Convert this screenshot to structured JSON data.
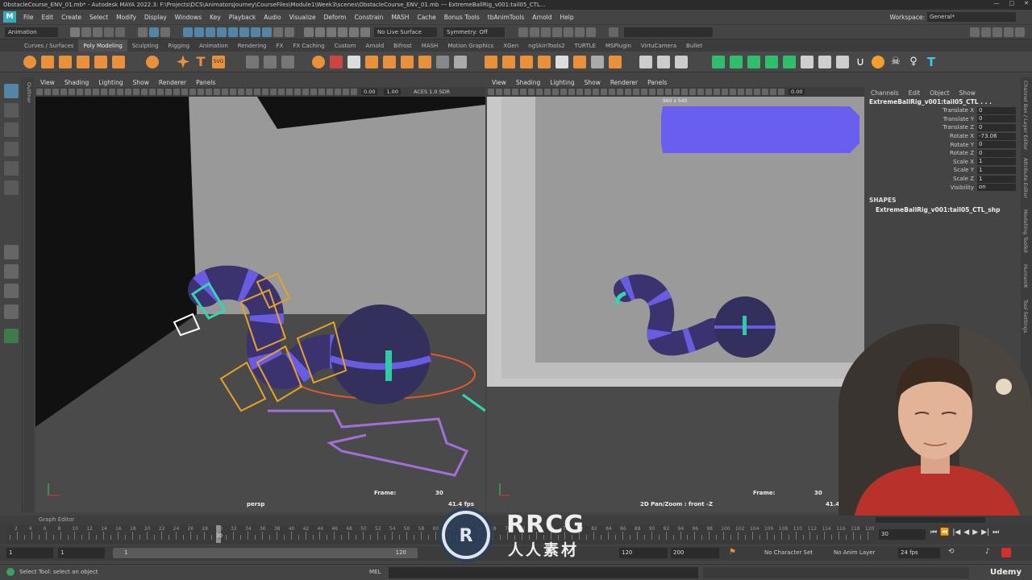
{
  "window": {
    "title": "ObstacleCourse_ENV_01.mb* - Autodesk MAYA 2022.3: F:\\Projects\\DCS\\AnimatorsJourney\\CourseFiles\\Module1\\Week3\\scenes\\ObstacleCourse_ENV_01.mb  ---  ExtremeBallRig_v001:tail05_CTL..."
  },
  "menubar": {
    "items": [
      "File",
      "Edit",
      "Create",
      "Select",
      "Modify",
      "Display",
      "Windows",
      "Key",
      "Playback",
      "Audio",
      "Visualize",
      "Deform",
      "Constrain",
      "MASH",
      "Cache",
      "Bonus Tools",
      "tbAnimTools",
      "Arnold",
      "Help"
    ],
    "workspace_label": "Workspace:",
    "workspace_value": "General*"
  },
  "statusline": {
    "mode": "Animation",
    "live_surface": "No Live Surface",
    "symmetry": "Symmetry: Off"
  },
  "shelf": {
    "tabs": [
      "Curves / Surfaces",
      "Poly Modeling",
      "Sculpting",
      "Rigging",
      "Animation",
      "Rendering",
      "FX",
      "FX Caching",
      "Custom",
      "Arnold",
      "Bifrost",
      "MASH",
      "Motion Graphics",
      "XGen",
      "ngSkinTools2",
      "TURTLE",
      "MSPlugin",
      "VirtuCamera",
      "Bullet"
    ],
    "active_tab": "Poly Modeling"
  },
  "outliner_tab": "Outliner",
  "viewport_left": {
    "menu": [
      "View",
      "Shading",
      "Lighting",
      "Show",
      "Renderer",
      "Panels"
    ],
    "field1": "0.00",
    "field2": "1.00",
    "colorspace": "ACES 1.0 SDR",
    "frame_label": "Frame:",
    "frame_value": "30",
    "camera": "persp",
    "fps": "41.4 fps"
  },
  "viewport_right": {
    "menu": [
      "View",
      "Shading",
      "Lighting",
      "Show",
      "Renderer",
      "Panels"
    ],
    "field1": "0.00",
    "resolution": "960 x 540",
    "frame_label": "Frame:",
    "frame_value": "30",
    "camera": "2D Pan/Zoom : front -Z",
    "fps": "41.4"
  },
  "channelbox": {
    "menu": [
      "Channels",
      "Edit",
      "Object",
      "Show"
    ],
    "object": "ExtremeBallRig_v001:tail05_CTL . . .",
    "attributes": [
      {
        "name": "Translate X",
        "value": "0"
      },
      {
        "name": "Translate Y",
        "value": "0"
      },
      {
        "name": "Translate Z",
        "value": "0"
      },
      {
        "name": "Rotate X",
        "value": "-73.06"
      },
      {
        "name": "Rotate Y",
        "value": "0"
      },
      {
        "name": "Rotate Z",
        "value": "0"
      },
      {
        "name": "Scale X",
        "value": "1"
      },
      {
        "name": "Scale Y",
        "value": "1"
      },
      {
        "name": "Scale Z",
        "value": "1"
      },
      {
        "name": "Visibility",
        "value": "on"
      }
    ],
    "shapes_header": "SHAPES",
    "shape_name": "ExtremeBallRig_v001:tail05_CTL_shp"
  },
  "side_tabs": [
    "Channel Box / Layer Editor",
    "Attribute Editor",
    "Modelling Toolkit",
    "HumanIK",
    "Tool Settings"
  ],
  "graph_editor_label": "Graph Editor",
  "timeline": {
    "labels": [
      "2",
      "4",
      "6",
      "8",
      "10",
      "12",
      "14",
      "16",
      "18",
      "20",
      "22",
      "24",
      "26",
      "28",
      "30",
      "32",
      "34",
      "36",
      "38",
      "40",
      "42",
      "44",
      "46",
      "48",
      "50",
      "52",
      "54",
      "56",
      "58",
      "60",
      "62",
      "64",
      "66",
      "68",
      "70",
      "72",
      "74",
      "76",
      "78",
      "80",
      "82",
      "84",
      "86",
      "88",
      "90",
      "92",
      "94",
      "96",
      "98",
      "100",
      "102",
      "104",
      "106",
      "108",
      "110",
      "112",
      "114",
      "116",
      "118",
      "120"
    ],
    "current_frame": "30",
    "current_frame_field": "30"
  },
  "range": {
    "start": "1",
    "playback_start": "1",
    "slider_start": "1",
    "slider_end": "120",
    "playback_end": "120",
    "end": "200",
    "character_set": "No Character Set",
    "anim_layer": "No Anim Layer",
    "fps": "24 fps"
  },
  "helpline": {
    "message": "Select Tool: select an object",
    "mel_label": "MEL"
  },
  "watermark": {
    "brand": "RRCG",
    "subtitle": "人人素材",
    "corner": "Udemy"
  },
  "colors": {
    "accent": "#5285a6",
    "ball": "#3a3370",
    "stripe": "#6a5ce0",
    "ctl_yellow": "#e6a22a",
    "ctl_cyan": "#33d6b0",
    "path_purple": "#a070d8",
    "key_red": "#d03030"
  }
}
